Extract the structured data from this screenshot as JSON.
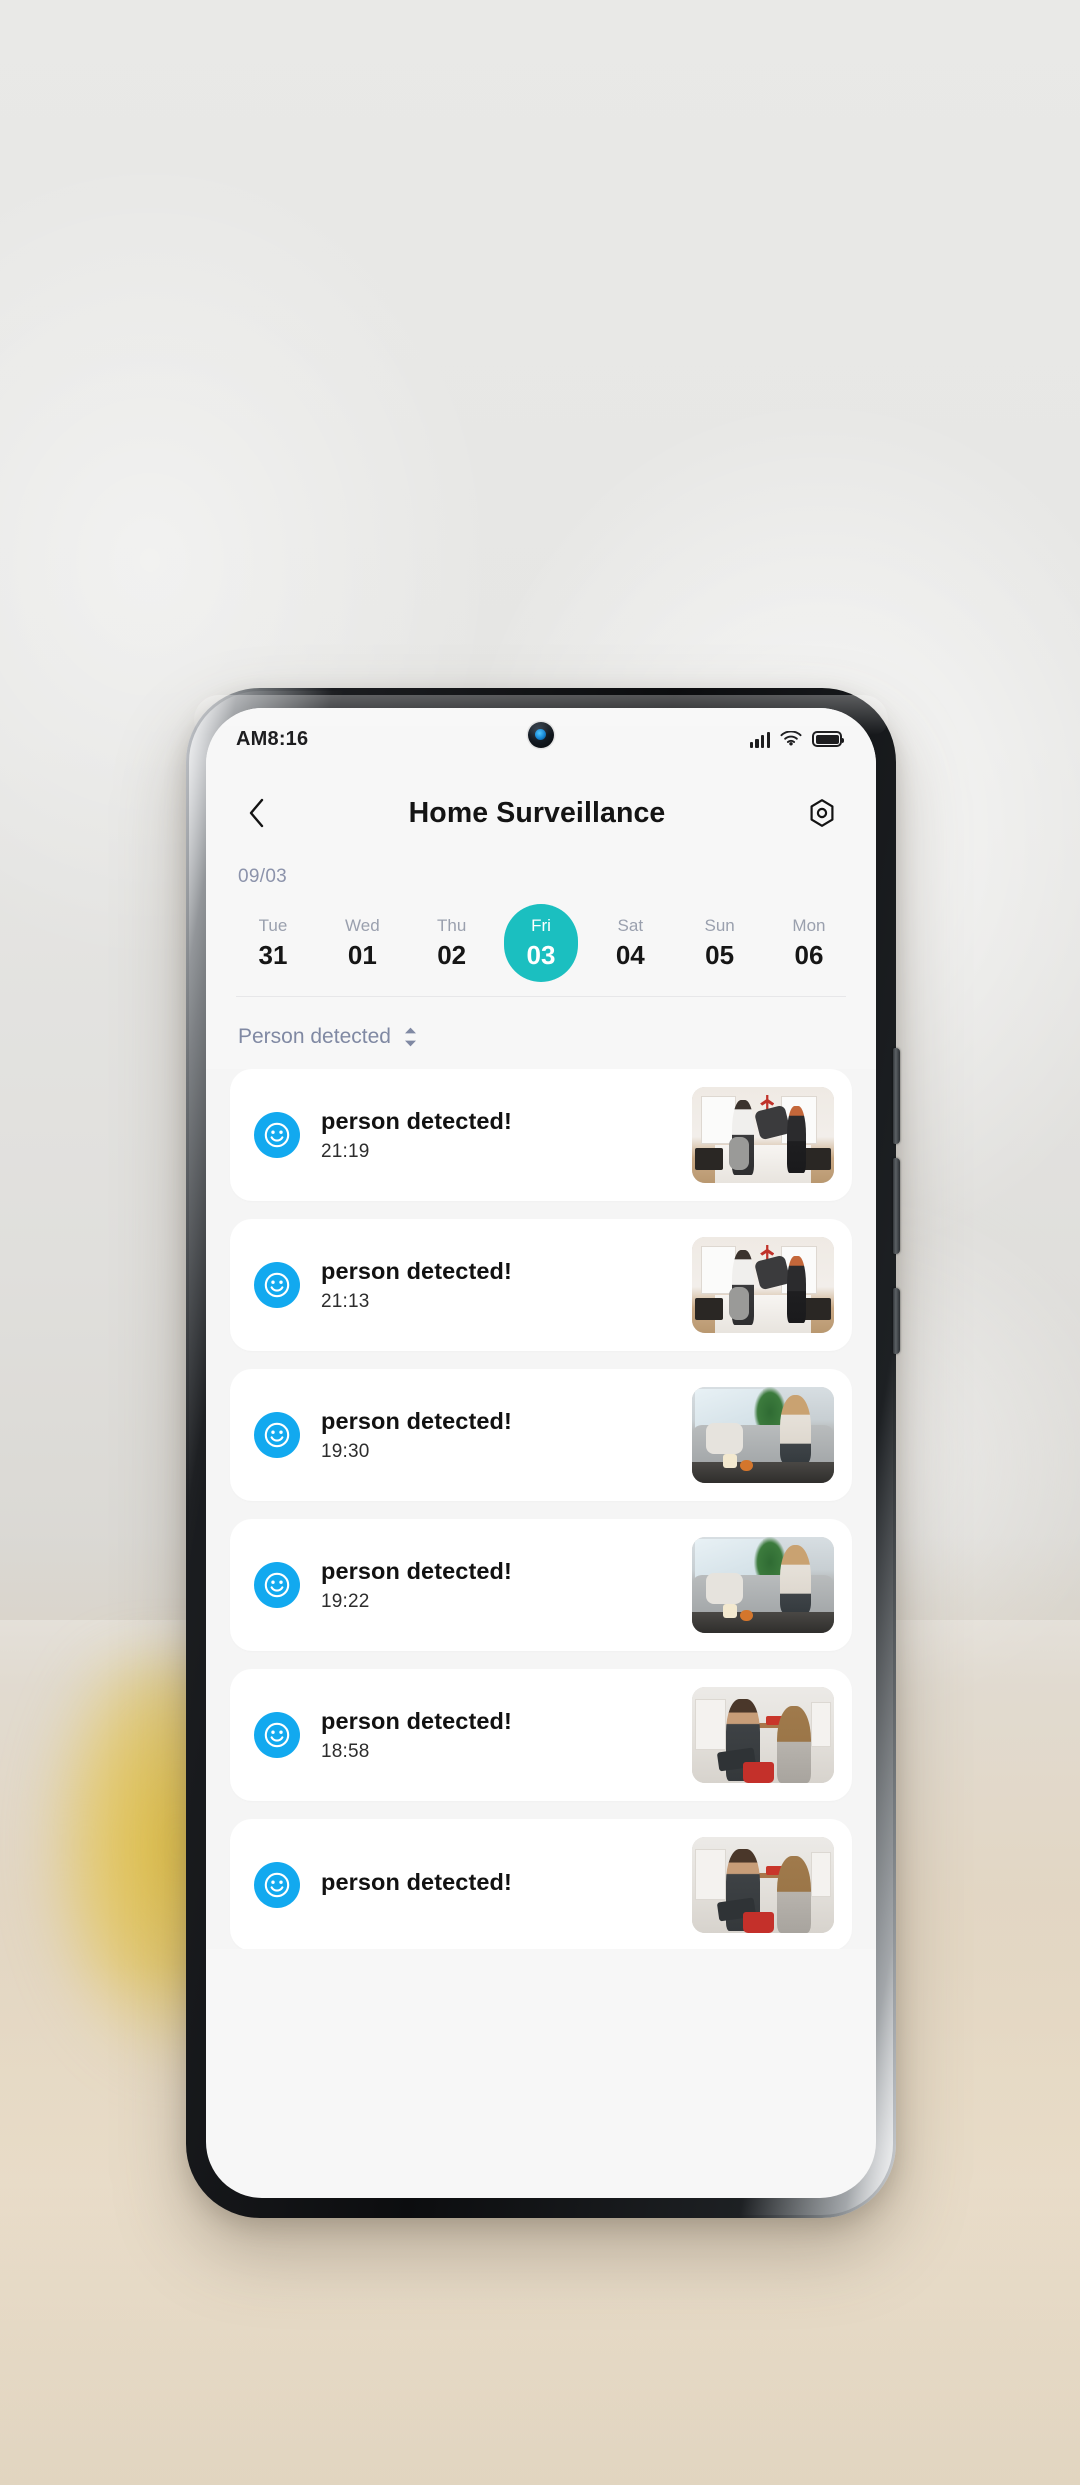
{
  "status_bar": {
    "time": "AM8:16",
    "icons": [
      "signal-icon",
      "wifi-icon",
      "battery-icon"
    ]
  },
  "header": {
    "back_icon": "chevron-left-icon",
    "title": "Home Surveillance",
    "settings_icon": "hex-settings-icon"
  },
  "date_strip": {
    "month_label": "09/03",
    "days": [
      {
        "dow": "Tue",
        "num": "31",
        "selected": false
      },
      {
        "dow": "Wed",
        "num": "01",
        "selected": false
      },
      {
        "dow": "Thu",
        "num": "02",
        "selected": false
      },
      {
        "dow": "Fri",
        "num": "03",
        "selected": true
      },
      {
        "dow": "Sat",
        "num": "04",
        "selected": false
      },
      {
        "dow": "Sun",
        "num": "05",
        "selected": false
      },
      {
        "dow": "Mon",
        "num": "06",
        "selected": false
      }
    ]
  },
  "filter": {
    "label": "Person detected",
    "icon": "chevron-updown-icon"
  },
  "events": [
    {
      "icon": "smiley-face-icon",
      "title": "person detected!",
      "time": "21:19",
      "scene": "bedroom"
    },
    {
      "icon": "smiley-face-icon",
      "title": "person detected!",
      "time": "21:13",
      "scene": "bedroom"
    },
    {
      "icon": "smiley-face-icon",
      "title": "person detected!",
      "time": "19:30",
      "scene": "sofa"
    },
    {
      "icon": "smiley-face-icon",
      "title": "person detected!",
      "time": "19:22",
      "scene": "sofa"
    },
    {
      "icon": "smiley-face-icon",
      "title": "person detected!",
      "time": "18:58",
      "scene": "kitchen"
    },
    {
      "icon": "smiley-face-icon",
      "title": "person detected!",
      "time": "",
      "scene": "kitchen"
    }
  ],
  "colors": {
    "accent_teal": "#1bbfc0",
    "icon_blue": "#12a9ef",
    "screen_bg": "#f5f5f5",
    "card_bg": "#ffffff",
    "muted_text": "#8089a3"
  }
}
